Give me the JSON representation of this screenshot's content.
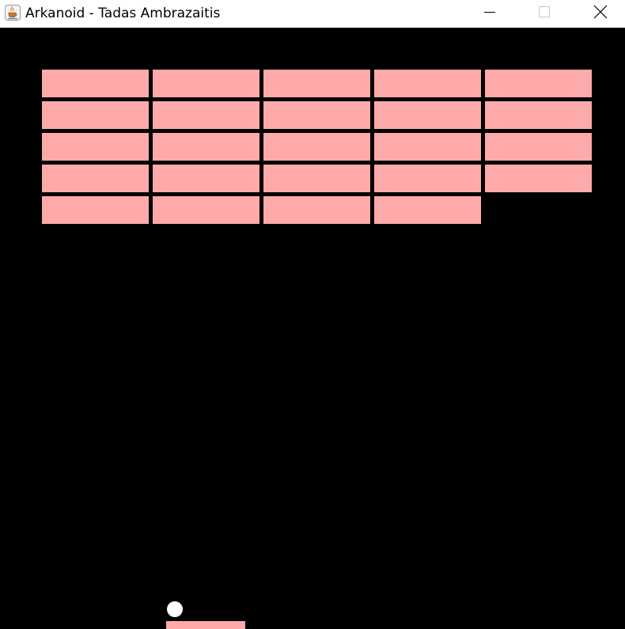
{
  "window": {
    "title": "Arkanoid - Tadas Ambrazaitis",
    "app_icon": "java-coffee-cup-icon",
    "controls": {
      "minimize_icon": "minimize-icon",
      "maximize_icon": "maximize-icon",
      "close_icon": "close-icon"
    }
  },
  "game": {
    "background_color": "#000000",
    "brick_color": "#ffaaaa",
    "ball_color": "#ffffff",
    "paddle_color": "#ffaaaa",
    "grid": {
      "columns": 5,
      "rows": 5
    },
    "bricks": [
      {
        "row": 0,
        "col": 0
      },
      {
        "row": 0,
        "col": 1
      },
      {
        "row": 0,
        "col": 2
      },
      {
        "row": 0,
        "col": 3
      },
      {
        "row": 0,
        "col": 4
      },
      {
        "row": 1,
        "col": 0
      },
      {
        "row": 1,
        "col": 1
      },
      {
        "row": 1,
        "col": 2
      },
      {
        "row": 1,
        "col": 3
      },
      {
        "row": 1,
        "col": 4
      },
      {
        "row": 2,
        "col": 0
      },
      {
        "row": 2,
        "col": 1
      },
      {
        "row": 2,
        "col": 2
      },
      {
        "row": 2,
        "col": 3
      },
      {
        "row": 2,
        "col": 4
      },
      {
        "row": 3,
        "col": 0
      },
      {
        "row": 3,
        "col": 1
      },
      {
        "row": 3,
        "col": 2
      },
      {
        "row": 3,
        "col": 3
      },
      {
        "row": 3,
        "col": 4
      },
      {
        "row": 4,
        "col": 0
      },
      {
        "row": 4,
        "col": 1
      },
      {
        "row": 4,
        "col": 2
      },
      {
        "row": 4,
        "col": 3
      }
    ]
  }
}
